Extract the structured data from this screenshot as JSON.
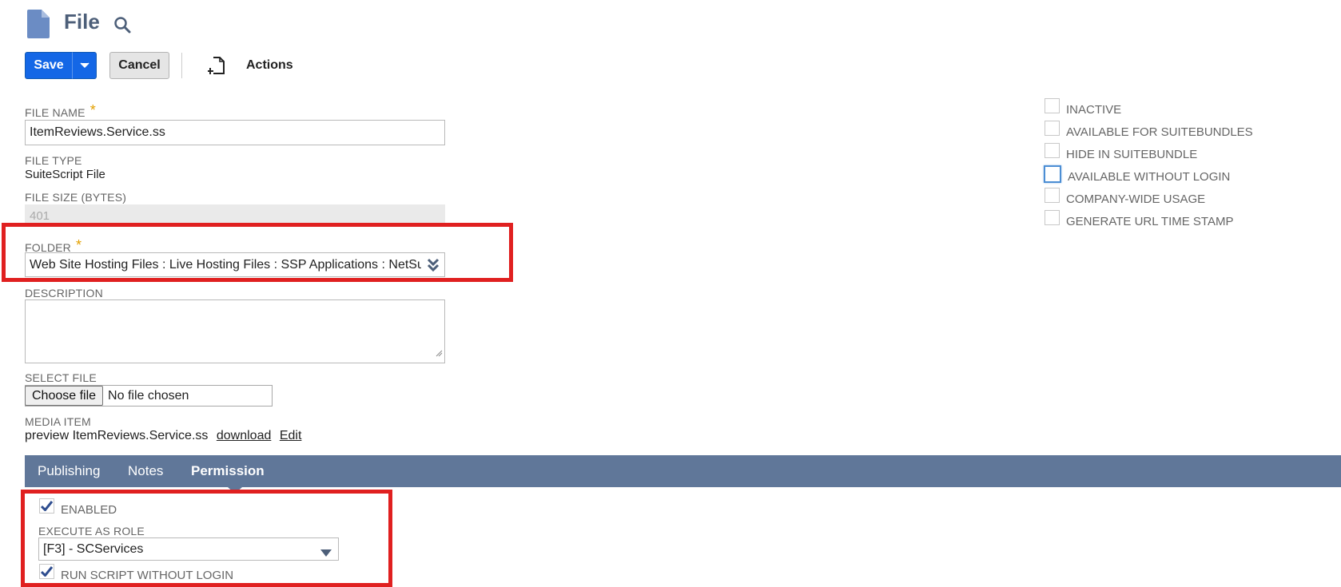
{
  "header": {
    "title": "File",
    "page_icon": "file-icon",
    "search_icon": "search-icon"
  },
  "toolbar": {
    "save_label": "Save",
    "cancel_label": "Cancel",
    "actions_label": "Actions",
    "primary_color": "#1467e6"
  },
  "form": {
    "file_name": {
      "label": "FILE NAME",
      "required": "*",
      "value": "ItemReviews.Service.ss"
    },
    "file_type": {
      "label": "FILE TYPE",
      "value": "SuiteScript File"
    },
    "file_size": {
      "label": "FILE SIZE (BYTES)",
      "value": "401"
    },
    "folder": {
      "label": "FOLDER",
      "required": "*",
      "value": "Web Site Hosting Files : Live Hosting Files : SSP Applications : NetSuite Inc. - SCA"
    },
    "description": {
      "label": "DESCRIPTION",
      "value": ""
    },
    "select_file": {
      "label": "SELECT FILE",
      "button": "Choose file",
      "status": "No file chosen"
    },
    "media_item": {
      "label": "MEDIA ITEM",
      "preview": "preview ItemReviews.Service.ss",
      "download": "download",
      "edit": "Edit"
    }
  },
  "checkboxes": [
    {
      "label": "INACTIVE",
      "checked": false
    },
    {
      "label": "AVAILABLE FOR SUITEBUNDLES",
      "checked": false
    },
    {
      "label": "HIDE IN SUITEBUNDLE",
      "checked": false
    },
    {
      "label": "AVAILABLE WITHOUT LOGIN",
      "checked": false,
      "focused": true
    },
    {
      "label": "COMPANY-WIDE USAGE",
      "checked": false
    },
    {
      "label": "GENERATE URL TIME STAMP",
      "checked": false
    }
  ],
  "tabs": [
    {
      "label": "Publishing",
      "active": false
    },
    {
      "label": "Notes",
      "active": false
    },
    {
      "label": "Permission",
      "active": true
    }
  ],
  "permission": {
    "enabled": {
      "label": "ENABLED",
      "checked": true
    },
    "execute_as_role": {
      "label": "EXECUTE AS ROLE",
      "value": "[F3] - SCServices"
    },
    "run_without_login": {
      "label": "RUN SCRIPT WITHOUT LOGIN",
      "checked": true
    }
  },
  "colors": {
    "tab_bar": "#607799",
    "highlight_box": "#e02020",
    "title": "#4d5f79"
  }
}
